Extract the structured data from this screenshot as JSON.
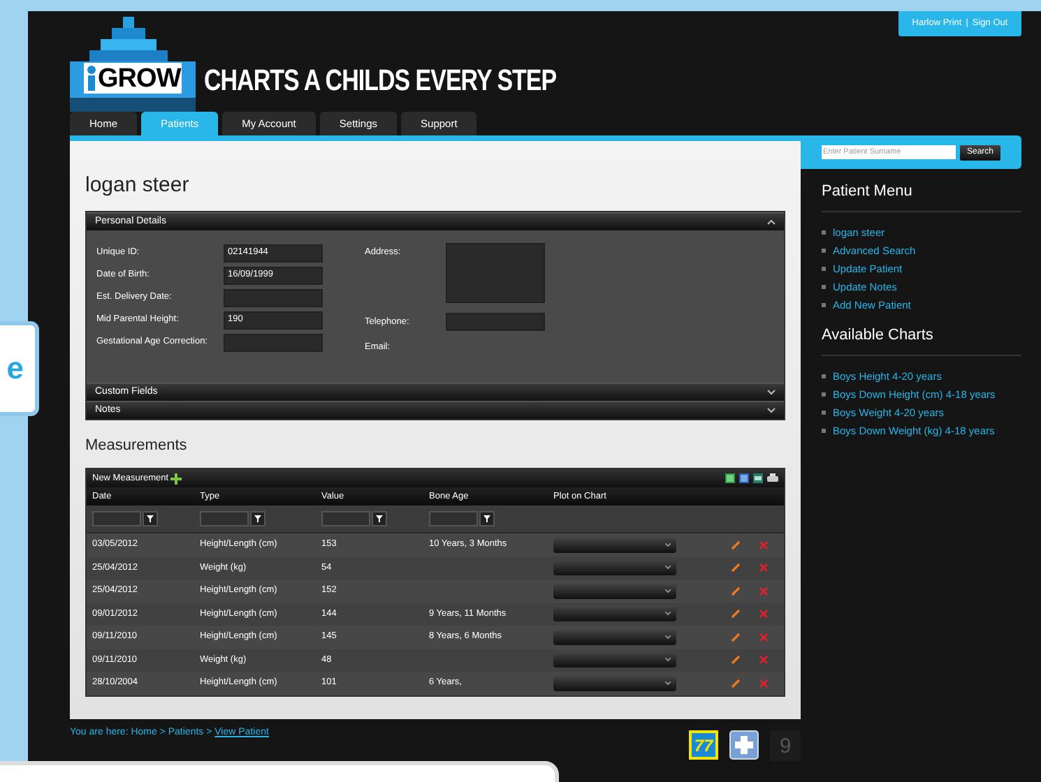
{
  "header": {
    "user_name": "Harlow Print",
    "separator": "|",
    "sign_out": "Sign Out"
  },
  "logo": {
    "brand": "GROW",
    "tagline": "CHARTS A CHILDS EVERY STEP"
  },
  "tabs": [
    {
      "label": "Home",
      "selected": false
    },
    {
      "label": "Patients",
      "selected": true
    },
    {
      "label": "My Account",
      "selected": false
    },
    {
      "label": "Settings",
      "selected": false
    },
    {
      "label": "Support",
      "selected": false
    }
  ],
  "patient_name": "logan steer",
  "sections": [
    {
      "title": "Personal Details",
      "expanded": true
    },
    {
      "title": "Custom Fields",
      "expanded": false
    },
    {
      "title": "Notes",
      "expanded": false
    }
  ],
  "personal_details": {
    "left": [
      {
        "label": "Unique ID:",
        "value": "02141944"
      },
      {
        "label": "Date of Birth:",
        "value": "16/09/1999"
      },
      {
        "label": "Est. Delivery Date:"
      },
      {
        "label": "Mid Parental Height:",
        "value": "190"
      },
      {
        "label": "Gestational Age Correction:"
      }
    ],
    "right": [
      {
        "label": "Address:",
        "kind": "textarea"
      },
      {
        "label": "Telephone:",
        "kind": "input"
      },
      {
        "label": "Email:",
        "kind": "none"
      }
    ]
  },
  "measurements": {
    "title": "Measurements",
    "new_label": "New Measurement",
    "columns": [
      "Date",
      "Type",
      "Value",
      "Bone Age",
      "Plot on Chart"
    ],
    "rows": [
      {
        "date": "03/05/2012",
        "type": "Height/Length (cm)",
        "value": "153",
        "bone_age": "10 Years, 3 Months"
      },
      {
        "date": "25/04/2012",
        "type": "Weight (kg)",
        "value": "54"
      },
      {
        "date": "25/04/2012",
        "type": "Height/Length (cm)",
        "value": "152"
      },
      {
        "date": "09/01/2012",
        "type": "Height/Length (cm)",
        "value": "144",
        "bone_age": "9 Years, 11 Months"
      },
      {
        "date": "09/11/2010",
        "type": "Height/Length (cm)",
        "value": "145",
        "bone_age": "8 Years, 6 Months"
      },
      {
        "date": "09/11/2010",
        "type": "Weight (kg)",
        "value": "48"
      },
      {
        "date": "28/10/2004",
        "type": "Height/Length (cm)",
        "value": "101",
        "bone_age": "6 Years,"
      }
    ]
  },
  "sidebar": {
    "search_placeholder": "Enter Patient Surname",
    "search_button": "Search",
    "menus": [
      {
        "title": "Patient Menu",
        "items": [
          "logan steer",
          "Advanced Search",
          "Update Patient",
          "Update Notes",
          "Add New Patient"
        ]
      },
      {
        "title": "Available Charts",
        "items": [
          "Boys Height 4-20 years",
          "Boys Down Height (cm) 4-18 years",
          "Boys Weight 4-20 years",
          "Boys Down Weight (kg) 4-18 years"
        ]
      }
    ]
  },
  "footer": {
    "breadcrumb": "You are here: Home > Patients > ",
    "breadcrumb_link": "View Patient",
    "badge_text": "77",
    "counter": "9"
  },
  "overlay_card": {
    "text": "e"
  }
}
